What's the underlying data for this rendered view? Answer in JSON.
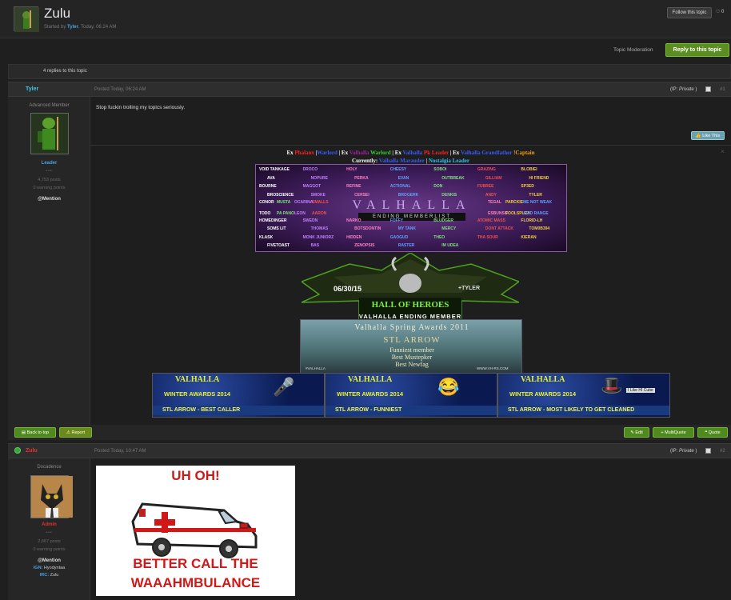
{
  "topic": {
    "title": "Zulu",
    "started_prefix": "Started by",
    "started_by": "Tyler",
    "started_when": ", Today, 06:24 AM",
    "follow_label": "Follow this topic",
    "follow_count": "0"
  },
  "actions": {
    "topic_moderation": "Topic Moderation",
    "reply_label": "Reply to this topic",
    "replies_count": "4 replies to this topic"
  },
  "post1": {
    "author": "Tyler",
    "date": "Posted Today, 06:24 AM",
    "ip_prefix": "(IP: ",
    "ip_value": "Private",
    "ip_suffix": ")",
    "number": "#1",
    "rank": "Advanced Member",
    "group": "Leader",
    "pips": "•••",
    "posts": "4,753 posts",
    "warnings": "0 warning points",
    "mention": "@Mention",
    "text": "Stop fuckin trolling my topics seriously.",
    "like_label": "Like This",
    "sig_close": "×",
    "sig_line1": [
      {
        "t": "Ex ",
        "c": "#ffffff"
      },
      {
        "t": "Phalanx ",
        "c": "#ff2020"
      },
      {
        "t": "|",
        "c": "#ffffff"
      },
      {
        "t": "Warlord ",
        "c": "#3a5aff"
      },
      {
        "t": "| Ex ",
        "c": "#ffffff"
      },
      {
        "t": "Valhalla ",
        "c": "#a020a0"
      },
      {
        "t": "Warlord ",
        "c": "#30d030"
      },
      {
        "t": "| Ex ",
        "c": "#ffffff"
      },
      {
        "t": "Valhalla ",
        "c": "#3a5aff"
      },
      {
        "t": "Pk Leader ",
        "c": "#ff2020"
      },
      {
        "t": "| Ex ",
        "c": "#ffffff"
      },
      {
        "t": "Valhalla Grandfather ",
        "c": "#3a5aff"
      },
      {
        "t": "!Captain",
        "c": "#f0a000"
      }
    ],
    "sig_line2": [
      {
        "t": "Currently: ",
        "c": "#ffffff"
      },
      {
        "t": "Valhalla Marauder ",
        "c": "#3a5aff"
      },
      {
        "t": "| ",
        "c": "#ffffff"
      },
      {
        "t": "Nostalgia Leader",
        "c": "#30c0f0"
      }
    ],
    "banner1_title": "VALHALLA",
    "banner1_sub": "ENDING MEMBERLIST",
    "banner1_words": [
      "VOID TANKAGE",
      "DROCO",
      "HOLY",
      "CHEESY",
      "SOBOI",
      "GRAZING",
      "BLOBIEI",
      "AVA",
      "NOPURE",
      "PERKA",
      "EVAN",
      "OUTBREAK",
      "GILLIAM",
      "HI FRIEND",
      "BOURNE",
      "MAGGOT",
      "REFINE",
      "ACTIONAL",
      "DON",
      "FUBREE",
      "SP3ED",
      "BROSCIENCE",
      "SMOKE",
      "CERSEI",
      "BROGERK",
      "DENKIS",
      "ANDY",
      "TYLER",
      "CONOR",
      "MUSTA",
      "OCARINA",
      "SMALLS",
      "TEGAL",
      "PARCKIE",
      "ME NOT WEAK",
      "TODO",
      "PA PANO",
      "LEON",
      "AARON",
      "ESBUNSO",
      "FOOLSPLEA",
      "ACID RANGE",
      "HOMEDINGER",
      "SWEDN",
      "NARKO",
      "FOFFY",
      "BLUDGER",
      "ATOMIC MASS",
      "FLORID-LH",
      "SOMS LIT",
      "THOMAS",
      "BOTSDONTIN",
      "MY TANK",
      "MERCY",
      "DONT ATTACK",
      "TOM0B394",
      "KLASK",
      "MONK JUNIORZ",
      "HIDDEN",
      "GAOGUD",
      "THEO",
      "THA SOUR",
      "KIERAN",
      "FIVETOAST",
      "BAS",
      "ZENOPSIS",
      "RASTER",
      "IM UDEA"
    ],
    "banner2_date": "06/30/15",
    "banner2_tyler": "+TYLER",
    "banner2_hall": "HALL OF HEROES",
    "banner2_valhalla": "VALHALLA ENDING MEMBER",
    "banner3_title": "Valhalla Spring Awards 2011",
    "banner3_award": "STL ARROW",
    "banner3_l1": "Funniest member",
    "banner3_l2": "Best Mustepker",
    "banner3_l3": "Best Newfag",
    "banner3_footl": "#VALHALLA",
    "banner3_footr": "WWW.VH-RS.COM",
    "winter": [
      {
        "v": "VALHALLA",
        "w": "WINTER AWARDS 2014",
        "b": "STL ARROW - BEST CALLER",
        "icon": "🎤"
      },
      {
        "v": "VALHALLA",
        "w": "WINTER AWARDS 2014",
        "b": "STL ARROW - FUNNIEST",
        "icon": "😂"
      },
      {
        "v": "VALHALLA",
        "w": "WINTER AWARDS 2014",
        "b": "STL ARROW - MOST LIKELY TO GET CLEANED",
        "icon": "🎩"
      }
    ],
    "winter_tag": "I Like HI Cube"
  },
  "footer": {
    "back_to_top": "Back to top",
    "report": "Report",
    "edit": "Edit",
    "multiquote": "MultiQuote",
    "quote": "Quote"
  },
  "post2": {
    "author": "Zulu",
    "date": "Posted Today, 10:47 AM",
    "ip_prefix": "(IP: ",
    "ip_value": "Private",
    "ip_suffix": ")",
    "number": "#2",
    "rank": "Docadence",
    "group": "Admin",
    "pips": "•••",
    "posts": "2,667 posts",
    "warnings": "0 warning points",
    "mention": "@Mention",
    "ign_label": "IGN:",
    "ign_value": "Hyodyntaa",
    "irc_label": "IRC:",
    "irc_value": "Zulu",
    "image_top": "UH OH!",
    "image_mid": "BETTER CALL THE",
    "image_bot": "WAAAHMBULANCE"
  },
  "colors": {
    "accent_green": "#5a8e22",
    "name_tyler": "#3ec6e8",
    "name_zulu": "#e83030",
    "leader": "#4aa0e0",
    "admin": "#e83030"
  }
}
